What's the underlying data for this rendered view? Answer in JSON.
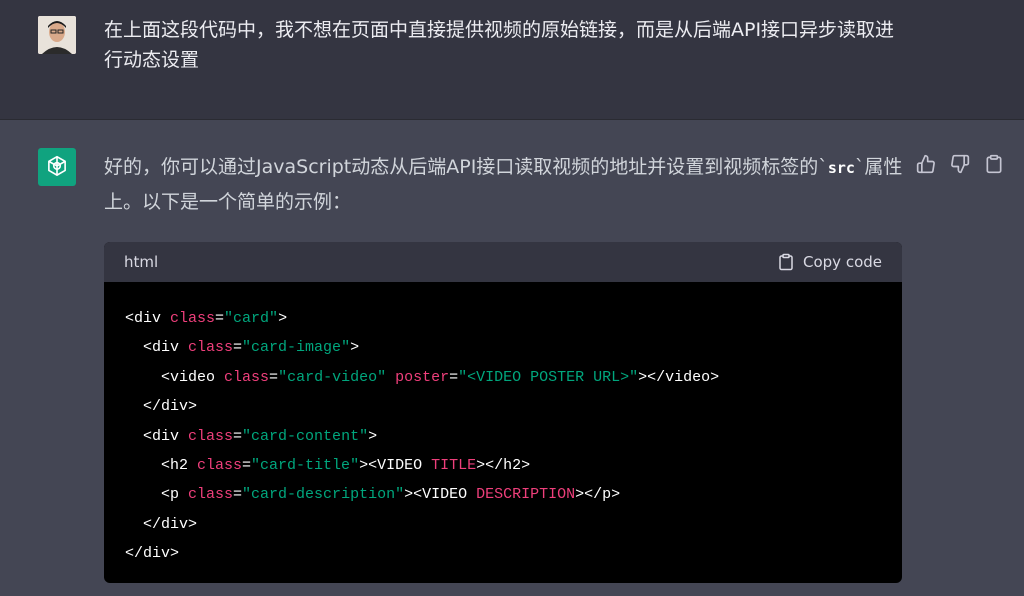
{
  "user_message": {
    "text": "在上面这段代码中，我不想在页面中直接提供视频的原始链接，而是从后端API接口异步读取进行动态设置"
  },
  "assistant_message": {
    "text_before_code": "好的，你可以通过JavaScript动态从后端API接口读取视频的地址并设置到视频标签的`",
    "inline_code": "src",
    "text_after_code": "`属性上。以下是一个简单的示例：",
    "actions": [
      "thumbs-up-icon",
      "thumbs-down-icon",
      "clipboard-icon"
    ]
  },
  "code_block": {
    "language": "html",
    "copy_label": "Copy code",
    "lines": [
      [
        {
          "t": "tag",
          "v": "<div "
        },
        {
          "t": "attr",
          "v": "class"
        },
        {
          "t": "tag",
          "v": "="
        },
        {
          "t": "str",
          "v": "\"card\""
        },
        {
          "t": "tag",
          "v": ">"
        }
      ],
      [
        {
          "t": "tag",
          "v": "  <div "
        },
        {
          "t": "attr",
          "v": "class"
        },
        {
          "t": "tag",
          "v": "="
        },
        {
          "t": "str",
          "v": "\"card-image\""
        },
        {
          "t": "tag",
          "v": ">"
        }
      ],
      [
        {
          "t": "tag",
          "v": "    <video "
        },
        {
          "t": "attr",
          "v": "class"
        },
        {
          "t": "tag",
          "v": "="
        },
        {
          "t": "str",
          "v": "\"card-video\""
        },
        {
          "t": "tag",
          "v": " "
        },
        {
          "t": "attr",
          "v": "poster"
        },
        {
          "t": "tag",
          "v": "="
        },
        {
          "t": "str",
          "v": "\"<VIDEO POSTER URL>\""
        },
        {
          "t": "tag",
          "v": "></video>"
        }
      ],
      [
        {
          "t": "tag",
          "v": "  </div>"
        }
      ],
      [
        {
          "t": "tag",
          "v": "  <div "
        },
        {
          "t": "attr",
          "v": "class"
        },
        {
          "t": "tag",
          "v": "="
        },
        {
          "t": "str",
          "v": "\"card-content\""
        },
        {
          "t": "tag",
          "v": ">"
        }
      ],
      [
        {
          "t": "tag",
          "v": "    <h2 "
        },
        {
          "t": "attr",
          "v": "class"
        },
        {
          "t": "tag",
          "v": "="
        },
        {
          "t": "str",
          "v": "\"card-title\""
        },
        {
          "t": "tag",
          "v": "><VIDEO "
        },
        {
          "t": "err",
          "v": "TITLE"
        },
        {
          "t": "tag",
          "v": "></h2>"
        }
      ],
      [
        {
          "t": "tag",
          "v": "    <p "
        },
        {
          "t": "attr",
          "v": "class"
        },
        {
          "t": "tag",
          "v": "="
        },
        {
          "t": "str",
          "v": "\"card-description\""
        },
        {
          "t": "tag",
          "v": "><VIDEO "
        },
        {
          "t": "err",
          "v": "DESCRIPTION"
        },
        {
          "t": "tag",
          "v": "></p>"
        }
      ],
      [
        {
          "t": "tag",
          "v": "  </div>"
        }
      ],
      [
        {
          "t": "tag",
          "v": "</div>"
        }
      ]
    ]
  },
  "colors": {
    "user_bg": "#343541",
    "assistant_bg": "#444654",
    "brand_green": "#10a37f",
    "code_attr": "#ee3f7b",
    "code_string": "#00a67d"
  }
}
